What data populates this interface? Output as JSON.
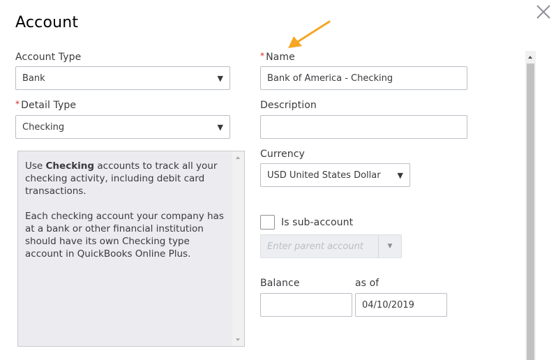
{
  "dialog": {
    "title": "Account",
    "close_icon": "close-icon"
  },
  "form": {
    "account_type": {
      "label": "Account Type",
      "value": "Bank"
    },
    "detail_type": {
      "label": "Detail Type",
      "value": "Checking",
      "required_marker": "*"
    },
    "name": {
      "label": "Name",
      "value": "Bank of America - Checking",
      "required_marker": "*"
    },
    "description": {
      "label": "Description",
      "value": ""
    },
    "currency": {
      "label": "Currency",
      "value": "USD United States Dollar"
    },
    "sub_account": {
      "label": "Is sub-account",
      "checked": false
    },
    "parent_account": {
      "placeholder": "Enter parent account",
      "value": ""
    },
    "balance": {
      "label": "Balance",
      "value": ""
    },
    "as_of": {
      "label": "as of",
      "value": "04/10/2019"
    }
  },
  "detail_description": {
    "para1_prefix": "Use ",
    "para1_bold": "Checking",
    "para1_suffix": " accounts to track all your checking activity, including debit card transactions.",
    "para2": "Each checking account your company has at a bank or other financial institution should have its own Checking type account in QuickBooks Online Plus."
  },
  "annotation": {
    "arrow_color": "#f5a623"
  },
  "colors": {
    "required": "#d52b1e",
    "panel_bg": "#ececf0"
  }
}
